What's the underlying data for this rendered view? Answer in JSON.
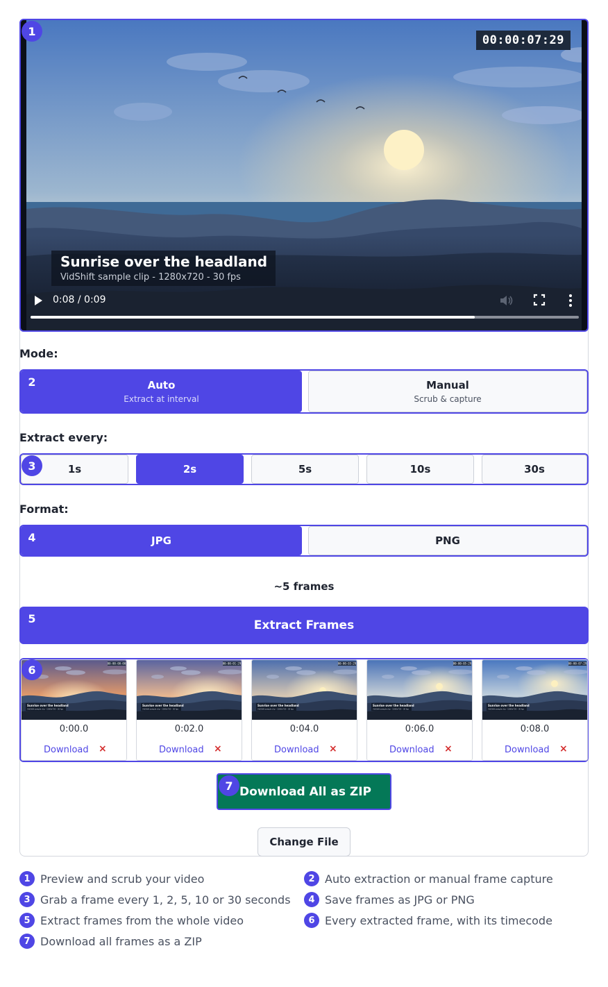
{
  "video": {
    "timecode": "00:00:07:29",
    "title": "Sunrise over the headland",
    "subtitle": "VidShift sample clip - 1280x720 - 30 fps",
    "time_display": "0:08 / 0:09",
    "progress": 0.81,
    "icons": [
      "play-icon",
      "volume-icon",
      "fullscreen-icon",
      "more-icon"
    ]
  },
  "badges": [
    "1",
    "2",
    "3",
    "4",
    "5",
    "6",
    "7"
  ],
  "mode": {
    "label": "Mode:",
    "options": [
      {
        "label": "Auto",
        "sub": "Extract at interval",
        "selected": true
      },
      {
        "label": "Manual",
        "sub": "Scrub & capture",
        "selected": false
      }
    ]
  },
  "interval": {
    "label": "Extract every:",
    "options": [
      {
        "label": "1s",
        "selected": false
      },
      {
        "label": "2s",
        "selected": true
      },
      {
        "label": "5s",
        "selected": false
      },
      {
        "label": "10s",
        "selected": false
      },
      {
        "label": "30s",
        "selected": false
      }
    ]
  },
  "format": {
    "label": "Format:",
    "options": [
      {
        "label": "JPG",
        "selected": true
      },
      {
        "label": "PNG",
        "selected": false
      }
    ]
  },
  "estimate": "~5 frames",
  "extract_button": "Extract Frames",
  "frames": [
    {
      "time": "0:00.0",
      "download": "Download",
      "remove": "×",
      "thumb_timecode": "00:00:00:00",
      "thumb_title": "Sunrise over the headland",
      "thumb_sub": "VidShift sample clip - 1280x720 - 30 fps",
      "sky_top": "#5b5a8c",
      "sky_bottom": "#e49a6a"
    },
    {
      "time": "0:02.0",
      "download": "Download",
      "remove": "×",
      "thumb_timecode": "00:00:01:29",
      "thumb_title": "Sunrise over the headland",
      "thumb_sub": "VidShift sample clip - 1280x720 - 30 fps",
      "sky_top": "#5a64a0",
      "sky_bottom": "#e8b690"
    },
    {
      "time": "0:04.0",
      "download": "Download",
      "remove": "×",
      "thumb_timecode": "00:00:03:29",
      "thumb_title": "Sunrise over the headland",
      "thumb_sub": "VidShift sample clip - 1280x720 - 30 fps",
      "sky_top": "#4d6fae",
      "sky_bottom": "#d6c6b2"
    },
    {
      "time": "0:06.0",
      "download": "Download",
      "remove": "×",
      "thumb_timecode": "00:00:05:29",
      "thumb_title": "Sunrise over the headland",
      "thumb_sub": "VidShift sample clip - 1280x720 - 30 fps",
      "sky_top": "#4a73b8",
      "sky_bottom": "#c8d0d6"
    },
    {
      "time": "0:08.0",
      "download": "Download",
      "remove": "×",
      "thumb_timecode": "00:00:07:29",
      "thumb_title": "Sunrise over the headland",
      "thumb_sub": "VidShift sample clip - 1280x720 - 30 fps",
      "sky_top": "#4a78c0",
      "sky_bottom": "#c2d0dc"
    }
  ],
  "zip_button": "Download All as ZIP",
  "change_button": "Change File",
  "legend": [
    {
      "n": "1",
      "text": "Preview and scrub your video"
    },
    {
      "n": "2",
      "text": "Auto extraction or manual frame capture"
    },
    {
      "n": "3",
      "text": "Grab a frame every 1, 2, 5, 10 or 30 seconds"
    },
    {
      "n": "4",
      "text": "Save frames as JPG or PNG"
    },
    {
      "n": "5",
      "text": "Extract frames from the whole video"
    },
    {
      "n": "6",
      "text": "Every extracted frame, with its timecode"
    },
    {
      "n": "7",
      "text": "Download all frames as a ZIP"
    }
  ],
  "colors": {
    "accent": "#4f46e5",
    "zip": "#047857",
    "remove": "#d42d2d"
  }
}
